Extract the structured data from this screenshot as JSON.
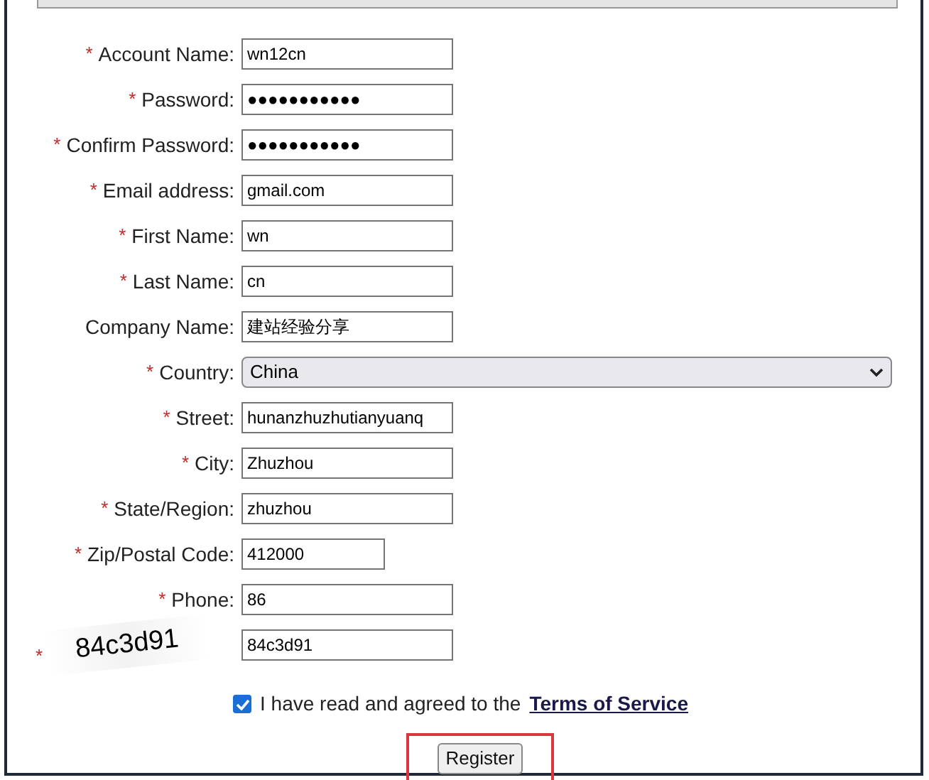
{
  "required_mark": "*",
  "fields": [
    {
      "kind": "text",
      "label": "Account Name:",
      "required": true,
      "value": "wn12cn"
    },
    {
      "kind": "password",
      "label": "Password:",
      "required": true,
      "value": "●●●●●●●●●●●"
    },
    {
      "kind": "password",
      "label": "Confirm Password:",
      "required": true,
      "value": "●●●●●●●●●●●"
    },
    {
      "kind": "text",
      "label": "Email address:",
      "required": true,
      "value": "gmail.com"
    },
    {
      "kind": "text",
      "label": "First Name:",
      "required": true,
      "value": "wn"
    },
    {
      "kind": "text",
      "label": "Last Name:",
      "required": true,
      "value": "cn"
    },
    {
      "kind": "text",
      "label": "Company Name:",
      "required": false,
      "value": "建站经验分享"
    },
    {
      "kind": "select",
      "label": "Country:",
      "required": true,
      "value": "China"
    },
    {
      "kind": "text",
      "label": "Street:",
      "required": true,
      "value": "hunanzhuzhutianyuanq"
    },
    {
      "kind": "text",
      "label": "City:",
      "required": true,
      "value": "Zhuzhou"
    },
    {
      "kind": "text",
      "label": "State/Region:",
      "required": true,
      "value": "zhuzhou"
    },
    {
      "kind": "short",
      "label": "Zip/Postal Code:",
      "required": true,
      "value": "412000"
    },
    {
      "kind": "text",
      "label": "Phone:",
      "required": true,
      "value": "86"
    },
    {
      "kind": "captcha",
      "captcha_text": "84c3d91",
      "required": true,
      "value": "84c3d91"
    }
  ],
  "agreement": {
    "checked": true,
    "text": "I have read and agreed to the",
    "link": "Terms of Service"
  },
  "register_button": {
    "label": "Register",
    "highlighted": true
  }
}
